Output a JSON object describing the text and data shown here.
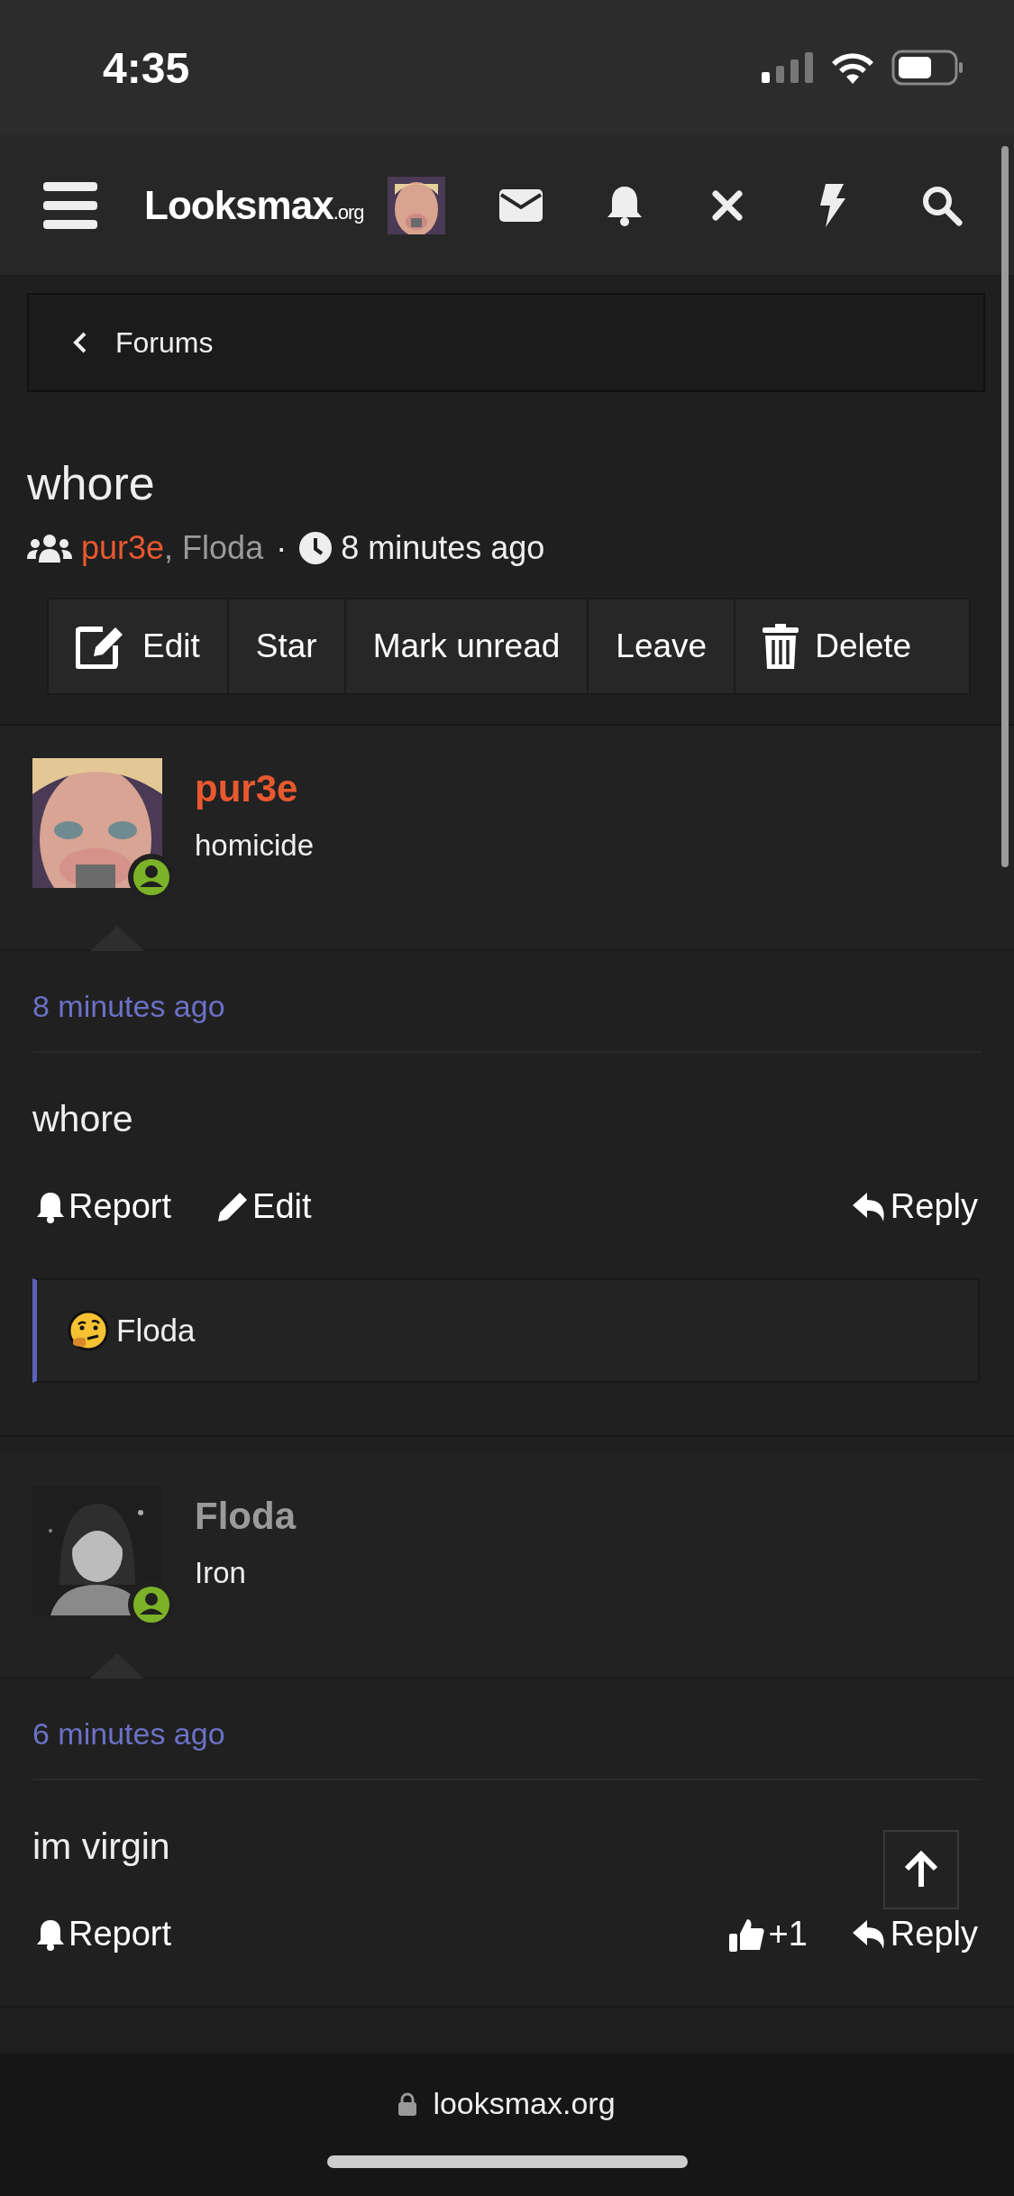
{
  "status_bar": {
    "time": "4:35"
  },
  "nav": {
    "logo": {
      "main": "Looksmax",
      "suffix": ".org"
    }
  },
  "breadcrumb": {
    "label": "Forums"
  },
  "conversation": {
    "title": "whore",
    "participants": [
      {
        "name": "pur3e",
        "color": "#e8592f"
      },
      {
        "name": "Floda",
        "color": "#9a9a9a"
      }
    ],
    "comma": ",",
    "separator": "·",
    "time": "8 minutes ago"
  },
  "actions": [
    {
      "kind": "edit",
      "label": "Edit"
    },
    {
      "kind": "plain",
      "label": "Star"
    },
    {
      "kind": "plain",
      "label": "Mark unread"
    },
    {
      "kind": "plain",
      "label": "Leave"
    },
    {
      "kind": "delete",
      "label": "Delete"
    }
  ],
  "messages": [
    {
      "user": "pur3e",
      "color": "#e8592f",
      "title": "homicide",
      "online": true,
      "time": "8 minutes ago",
      "body": "whore",
      "actions": [
        {
          "kind": "report",
          "label": "Report"
        },
        {
          "kind": "edit",
          "label": "Edit"
        },
        {
          "kind": "reply",
          "label": "Reply"
        }
      ],
      "reactions": {
        "user": "Floda"
      }
    },
    {
      "user": "Floda",
      "color": "#9a9a9a",
      "title": "Iron",
      "online": true,
      "time": "6 minutes ago",
      "body": "im virgin",
      "actions": [
        {
          "kind": "report",
          "label": "Report"
        },
        {
          "kind": "like",
          "label": "+1"
        },
        {
          "kind": "reply",
          "label": "Reply"
        }
      ]
    }
  ],
  "browser": {
    "url": "looksmax.org"
  }
}
